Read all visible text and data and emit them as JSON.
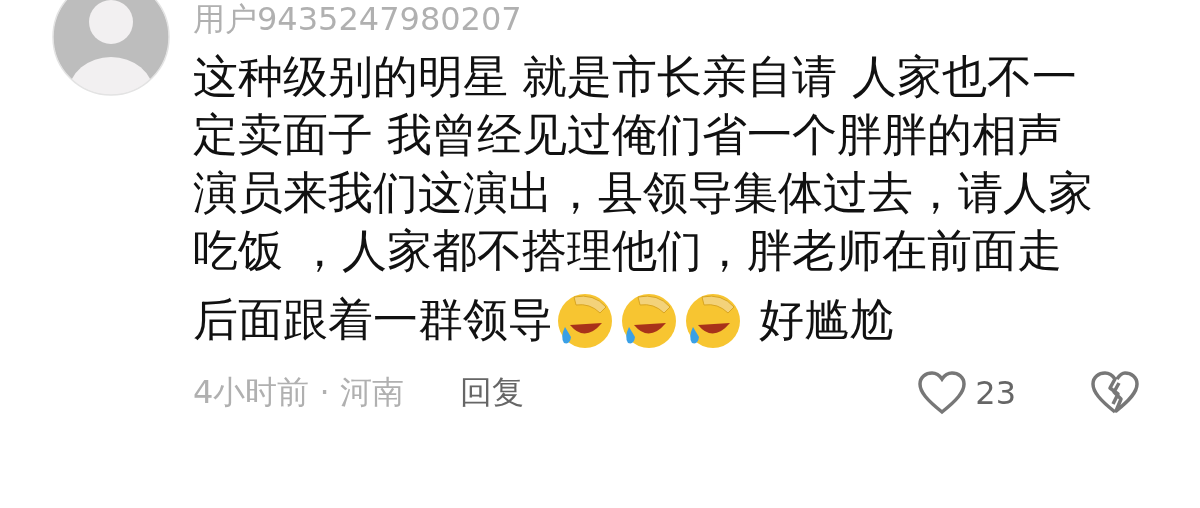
{
  "comment": {
    "username": "用户9435247980207",
    "lines": [
      "这种级别的明星 就是市长亲自请 人家也不一",
      "定卖面子 我曾经见过俺们省一个胖胖的相声",
      "演员来我们这演出，县领导集体过去，请人家",
      "吃饭 ，人家都不搭理他们，胖老师在前面走"
    ],
    "last_line": [
      {
        "kind": "text",
        "text": "后面跟着一群领导"
      },
      {
        "kind": "emoji"
      },
      {
        "kind": "emoji"
      },
      {
        "kind": "emoji"
      },
      {
        "kind": "text",
        "text": " 好尴尬"
      }
    ],
    "time": "4小时前",
    "separator": "·",
    "location": "河南",
    "reply": "回复",
    "likes": "23"
  }
}
